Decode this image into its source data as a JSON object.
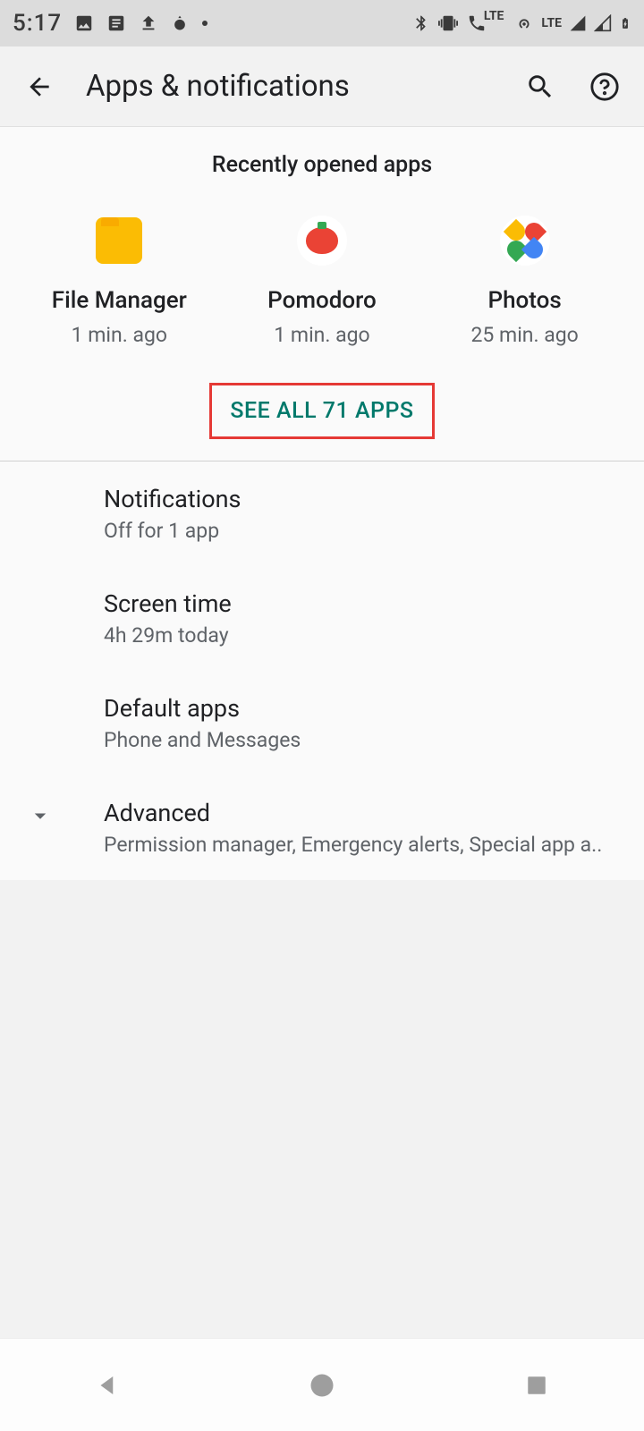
{
  "status": {
    "time": "5:17",
    "lte": "LTE"
  },
  "header": {
    "title": "Apps & notifications"
  },
  "recent": {
    "section_title": "Recently opened apps",
    "apps": [
      {
        "name": "File Manager",
        "time": "1 min. ago"
      },
      {
        "name": "Pomodoro",
        "time": "1 min. ago"
      },
      {
        "name": "Photos",
        "time": "25 min. ago"
      }
    ],
    "see_all": "SEE ALL 71 APPS"
  },
  "settings": [
    {
      "title": "Notifications",
      "sub": "Off for 1 app"
    },
    {
      "title": "Screen time",
      "sub": "4h 29m today"
    },
    {
      "title": "Default apps",
      "sub": "Phone and Messages"
    },
    {
      "title": "Advanced",
      "sub": "Permission manager, Emergency alerts, Special app a.."
    }
  ]
}
